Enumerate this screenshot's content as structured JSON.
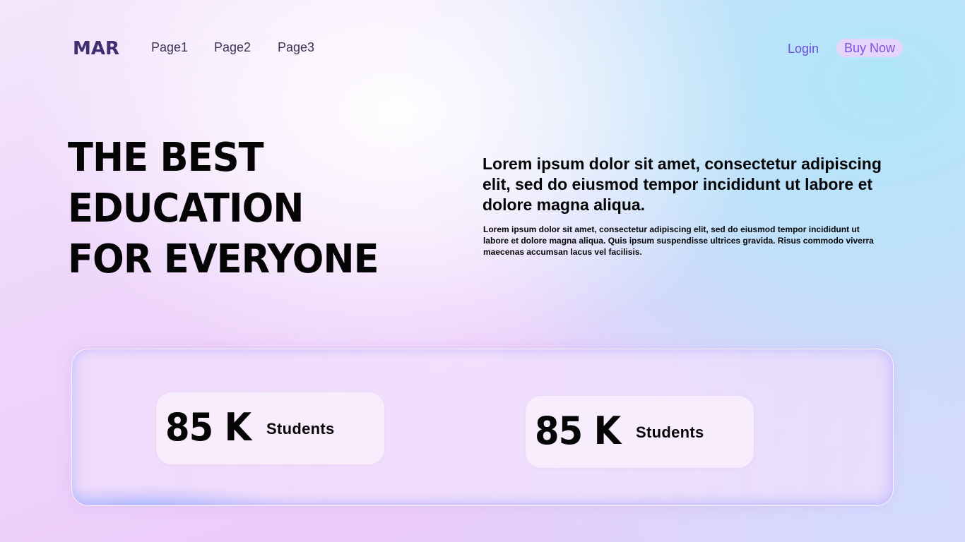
{
  "nav": {
    "logo": "MAR",
    "links": [
      "Page1",
      "Page2",
      "Page3"
    ],
    "login_label": "Login",
    "buy_now_label": "Buy Now"
  },
  "hero": {
    "title_lines": [
      "THE BEST",
      "EDUCATION",
      "FOR EVERYONE"
    ],
    "lead": "Lorem ipsum dolor sit amet, consectetur adipiscing elit, sed do eiusmod tempor incididunt ut labore et dolore magna aliqua.",
    "body": "Lorem ipsum dolor sit amet, consectetur adipiscing elit, sed do eiusmod tempor incididunt ut labore et dolore magna aliqua. Quis ipsum suspendisse ultrices gravida. Risus commodo viverra maecenas accumsan lacus vel facilisis."
  },
  "stats": [
    {
      "value": "85 K",
      "label": "Students"
    },
    {
      "value": "85 K",
      "label": "Students"
    }
  ],
  "colors": {
    "logo": "#3f2f6e",
    "accent": "#7b52df",
    "buy_now_bg": "#e6d4fb",
    "text": "#050505"
  }
}
